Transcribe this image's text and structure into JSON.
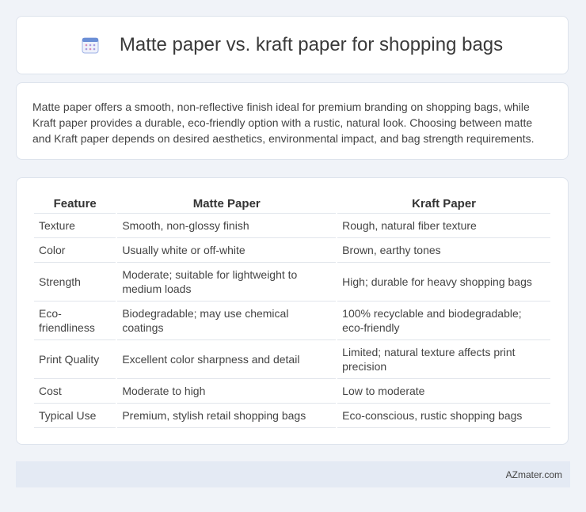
{
  "header": {
    "title": "Matte paper vs. kraft paper for shopping bags",
    "icon": "calendar-icon",
    "icon_color": "#6b8fd6"
  },
  "intro": {
    "text": "Matte paper offers a smooth, non-reflective finish ideal for premium branding on shopping bags, while Kraft paper provides a durable, eco-friendly option with a rustic, natural look. Choosing between matte and Kraft paper depends on desired aesthetics, environmental impact, and bag strength requirements."
  },
  "table": {
    "headers": [
      "Feature",
      "Matte Paper",
      "Kraft Paper"
    ],
    "rows": [
      [
        "Texture",
        "Smooth, non-glossy finish",
        "Rough, natural fiber texture"
      ],
      [
        "Color",
        "Usually white or off-white",
        "Brown, earthy tones"
      ],
      [
        "Strength",
        "Moderate; suitable for lightweight to medium loads",
        "High; durable for heavy shopping bags"
      ],
      [
        "Eco-friendliness",
        "Biodegradable; may use chemical coatings",
        "100% recyclable and biodegradable; eco-friendly"
      ],
      [
        "Print Quality",
        "Excellent color sharpness and detail",
        "Limited; natural texture affects print precision"
      ],
      [
        "Cost",
        "Moderate to high",
        "Low to moderate"
      ],
      [
        "Typical Use",
        "Premium, stylish retail shopping bags",
        "Eco-conscious, rustic shopping bags"
      ]
    ]
  },
  "footer": {
    "brand": "AZmater.com"
  }
}
